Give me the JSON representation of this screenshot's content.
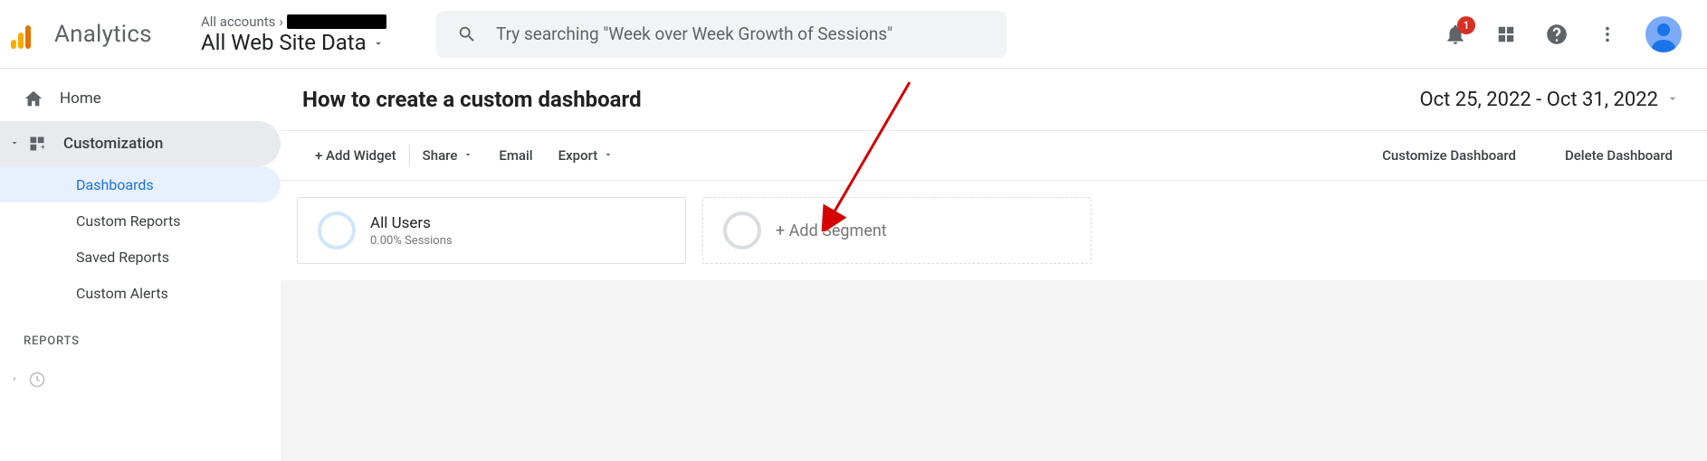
{
  "header": {
    "product_name": "Analytics",
    "account_crumb_prefix": "All accounts",
    "view_name": "All Web Site Data",
    "search_placeholder": "Try searching \"Week over Week Growth of Sessions\"",
    "notification_count": "1"
  },
  "sidebar": {
    "home_label": "Home",
    "customization_label": "Customization",
    "items": [
      {
        "label": "Dashboards"
      },
      {
        "label": "Custom Reports"
      },
      {
        "label": "Saved Reports"
      },
      {
        "label": "Custom Alerts"
      }
    ],
    "reports_header": "REPORTS"
  },
  "main": {
    "page_title": "How to create a custom dashboard",
    "date_range": "Oct 25, 2022 - Oct 31, 2022",
    "toolbar": {
      "add_widget": "+ Add Widget",
      "share": "Share",
      "email": "Email",
      "export": "Export",
      "customize": "Customize Dashboard",
      "delete": "Delete Dashboard"
    },
    "segments": {
      "all_users_name": "All Users",
      "all_users_sub": "0.00% Sessions",
      "add_label": "+ Add Segment"
    }
  }
}
